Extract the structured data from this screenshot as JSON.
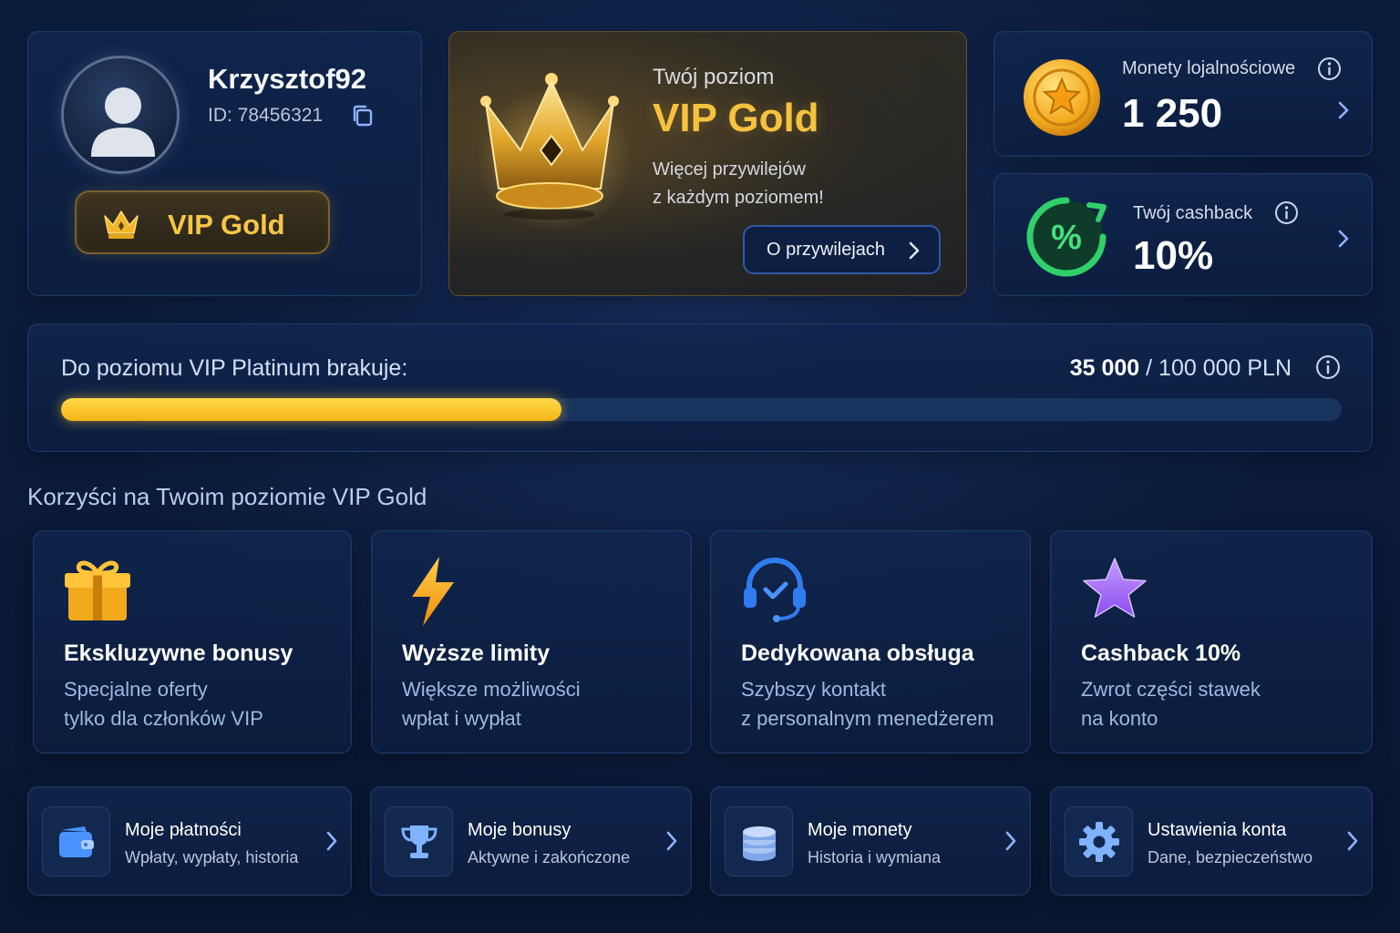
{
  "profile": {
    "username": "Krzysztof92",
    "id_text": "ID: 78456321",
    "vip_badge": "VIP Gold"
  },
  "vip_level": {
    "caption": "Twój poziom",
    "name": "VIP Gold",
    "desc_line1": "Więcej przywilejów",
    "desc_line2": "z każdym poziomem!",
    "button_label": "O przywilejach"
  },
  "coins": {
    "title": "Monety lojalnościowe",
    "value": "1 250"
  },
  "cashback": {
    "title": "Twój cashback",
    "value": "10%",
    "icon_symbol": "%"
  },
  "progress": {
    "label": "Do poziomu VIP Platinum brakuje:",
    "current": "35 000",
    "separator": " / ",
    "target": "100 000 PLN",
    "fraction": 0.35
  },
  "benefits_section": {
    "title": "Korzyści na Twoim poziomie VIP Gold",
    "items": [
      {
        "title": "Ekskluzywne bonusy",
        "line1": "Specjalne oferty",
        "line2": "tylko dla członków VIP",
        "icon": "gift-icon"
      },
      {
        "title": "Wyższe limity",
        "line1": "Większe możliwości",
        "line2": "wpłat i wypłat",
        "icon": "lightning-icon"
      },
      {
        "title": "Dedykowana obsługa",
        "line1": "Szybszy kontakt",
        "line2": "z personalnym menedżerem",
        "icon": "headset-icon"
      },
      {
        "title": "Cashback 10%",
        "line1": "Zwrot części stawek",
        "line2": "na konto",
        "icon": "star-icon"
      }
    ]
  },
  "nav": [
    {
      "title": "Moje płatności",
      "desc": "Wpłaty, wypłaty, historia",
      "icon": "wallet-icon"
    },
    {
      "title": "Moje bonusy",
      "desc": "Aktywne i zakończone",
      "icon": "trophy-icon"
    },
    {
      "title": "Moje monety",
      "desc": "Historia i wymiana",
      "icon": "coins-stack-icon"
    },
    {
      "title": "Ustawienia konta",
      "desc": "Dane, bezpieczeństwo",
      "icon": "gear-icon"
    }
  ],
  "colors": {
    "background": "#0a1a38",
    "gold": "#f6c23e",
    "progress_fill": "#f4b514",
    "progress_track": "#18345f",
    "cashback_green": "#2fd06a",
    "accent_blue": "#2f5aa6"
  }
}
